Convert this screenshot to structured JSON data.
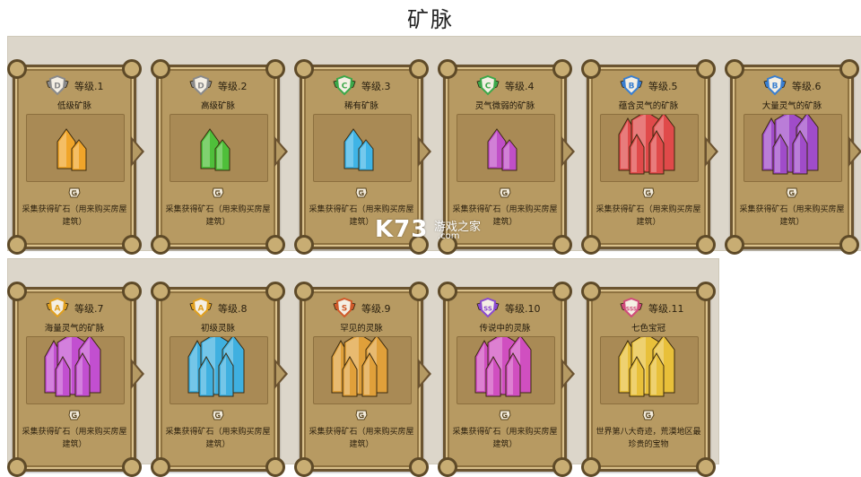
{
  "page_title": "矿脉",
  "watermark": {
    "logo": "K73",
    "name": "游戏之家",
    "url": ".com"
  },
  "ores": [
    {
      "level": "等级.1",
      "name": "低级矿脉",
      "grade": "D",
      "desc": "采集获得矿石（用来购买房屋建筑）",
      "gem_color": "#f0a52a"
    },
    {
      "level": "等级.2",
      "name": "高级矿脉",
      "grade": "D",
      "desc": "采集获得矿石（用来购买房屋建筑）",
      "gem_color": "#4fbf3a"
    },
    {
      "level": "等级.3",
      "name": "稀有矿脉",
      "grade": "C",
      "desc": "采集获得矿石（用来购买房屋建筑）",
      "gem_color": "#3fb4e6"
    },
    {
      "level": "等级.4",
      "name": "灵气微弱的矿脉",
      "grade": "C",
      "desc": "采集获得矿石（用来购买房屋建筑）",
      "gem_color": "#c04fc7"
    },
    {
      "level": "等级.5",
      "name": "蕴含灵气的矿脉",
      "grade": "B",
      "desc": "采集获得矿石（用来购买房屋建筑）",
      "gem_color": "#e04a4a"
    },
    {
      "level": "等级.6",
      "name": "大量灵气的矿脉",
      "grade": "B",
      "desc": "采集获得矿石（用来购买房屋建筑）",
      "gem_color": "#a04cc9"
    },
    {
      "level": "等级.7",
      "name": "海量灵气的矿脉",
      "grade": "A",
      "desc": "采集获得矿石（用来购买房屋建筑）",
      "gem_color": "#c24fd0"
    },
    {
      "level": "等级.8",
      "name": "初级灵脉",
      "grade": "A",
      "desc": "采集获得矿石（用来购买房屋建筑）",
      "gem_color": "#3fb0e0"
    },
    {
      "level": "等级.9",
      "name": "罕见的灵脉",
      "grade": "S",
      "desc": "采集获得矿石（用来购买房屋建筑）",
      "gem_color": "#e0a03a"
    },
    {
      "level": "等级.10",
      "name": "传说中的灵脉",
      "grade": "SS",
      "desc": "采集获得矿石（用来购买房屋建筑）",
      "gem_color": "#d04fc0"
    },
    {
      "level": "等级.11",
      "name": "七色宝冠",
      "grade": "SSS",
      "desc": "世界第八大奇迹，荒漠地区最珍贵的宝物",
      "gem_color": "#e8c03a"
    }
  ],
  "grade_colors": {
    "D": "#8a8a8a",
    "C": "#3da84a",
    "B": "#3a7fd0",
    "A": "#e0a020",
    "S": "#d05a2a",
    "SS": "#8a4ad0",
    "SSS": "#d04a7a"
  }
}
